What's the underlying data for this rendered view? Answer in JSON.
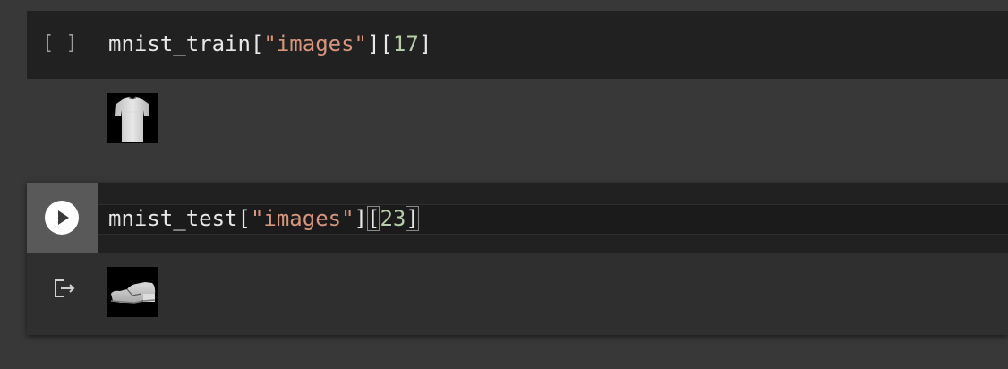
{
  "cells": [
    {
      "execution_count": "[ ]",
      "code": {
        "var": "mnist_train",
        "open_bracket": "[",
        "key": "\"images\"",
        "close_bracket": "]",
        "index_open": "[",
        "index": "17",
        "index_close": "]"
      },
      "output": {
        "image": "tshirt-image"
      }
    },
    {
      "run_icon": "play-icon",
      "code": {
        "var": "mnist_test",
        "open_bracket": "[",
        "key": "\"images\"",
        "close_bracket": "]",
        "index_open": "[",
        "index": "23",
        "index_close": "]"
      },
      "output_icon": "output-redirect-icon",
      "output": {
        "image": "shoe-image"
      }
    }
  ],
  "colors": {
    "background": "#383838",
    "editor": "#212121",
    "string": "#d6957c",
    "number": "#b5cea8",
    "text": "#e8e8e8"
  }
}
